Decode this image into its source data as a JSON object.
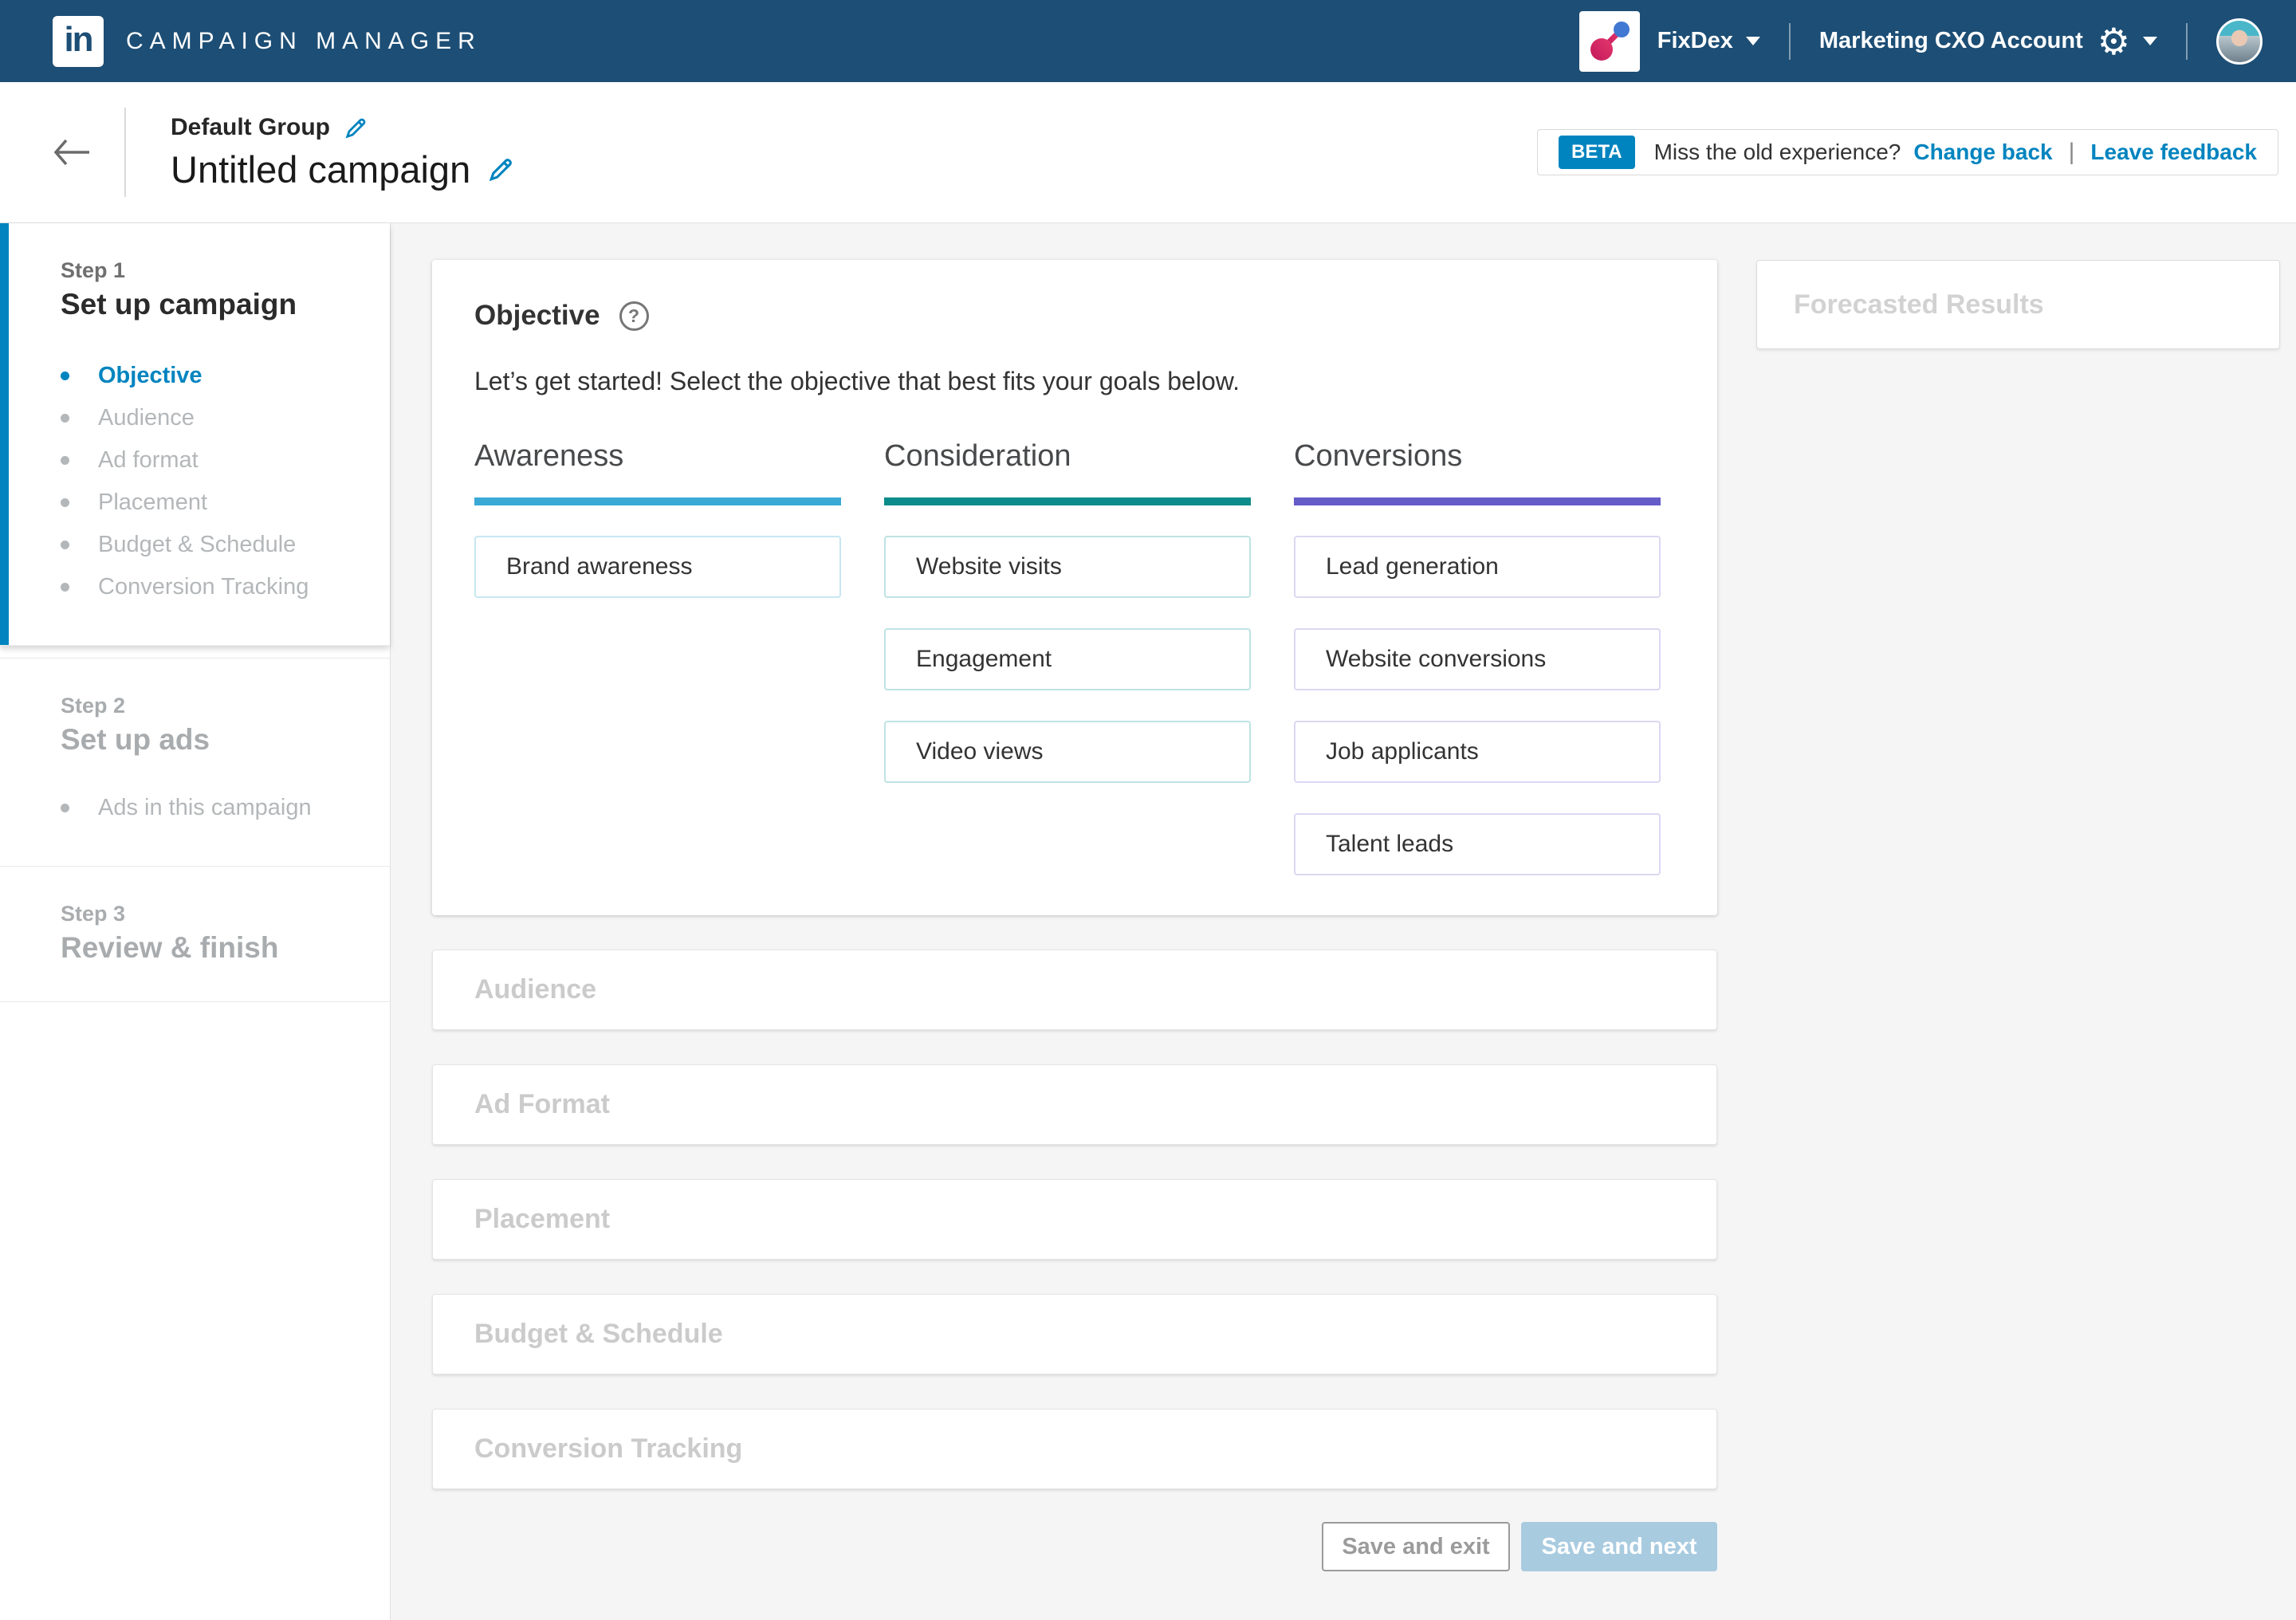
{
  "navbar": {
    "logo_text": "in",
    "app_title": "CAMPAIGN MANAGER",
    "partner": {
      "name": "FixDex"
    },
    "account": {
      "name": "Marketing CXO Account"
    }
  },
  "header": {
    "group_name": "Default Group",
    "campaign_name": "Untitled campaign",
    "beta": {
      "badge": "BETA",
      "message": "Miss the old experience?",
      "change_back": "Change back",
      "divider": "|",
      "leave_feedback": "Leave feedback"
    }
  },
  "sidebar": {
    "steps": [
      {
        "label": "Step 1",
        "title": "Set up campaign",
        "items": [
          {
            "label": "Objective",
            "active": true
          },
          {
            "label": "Audience",
            "active": false
          },
          {
            "label": "Ad format",
            "active": false
          },
          {
            "label": "Placement",
            "active": false
          },
          {
            "label": "Budget & Schedule",
            "active": false
          },
          {
            "label": "Conversion Tracking",
            "active": false
          }
        ]
      },
      {
        "label": "Step 2",
        "title": "Set up ads",
        "items": [
          {
            "label": "Ads in this campaign",
            "active": false
          }
        ]
      },
      {
        "label": "Step 3",
        "title": "Review & finish",
        "items": []
      }
    ]
  },
  "objective": {
    "title": "Objective",
    "help_glyph": "?",
    "intro": "Let’s get started! Select the objective that best fits your goals below.",
    "columns": [
      {
        "name": "Awareness",
        "accent_hex": "#3BA9D6",
        "border_hex": "#C8E6F2",
        "options": [
          "Brand awareness"
        ]
      },
      {
        "name": "Consideration",
        "accent_hex": "#0D8C8C",
        "border_hex": "#BFE3E3",
        "options": [
          "Website visits",
          "Engagement",
          "Video views"
        ]
      },
      {
        "name": "Conversions",
        "accent_hex": "#655CC9",
        "border_hex": "#DCD7F2",
        "options": [
          "Lead generation",
          "Website conversions",
          "Job applicants",
          "Talent leads"
        ]
      }
    ]
  },
  "collapsed_sections": [
    {
      "title": "Audience"
    },
    {
      "title": "Ad Format"
    },
    {
      "title": "Placement"
    },
    {
      "title": "Budget & Schedule"
    },
    {
      "title": "Conversion Tracking"
    }
  ],
  "footer_actions": {
    "save_exit": "Save and exit",
    "save_next": "Save and next"
  },
  "forecast": {
    "title": "Forecasted Results"
  },
  "colors": {
    "navbar_bg": "#1D4E75",
    "accent_blue": "#0084BF",
    "save_next_disabled_bg": "#A9CBE0",
    "page_bg": "#F5F5F6"
  }
}
